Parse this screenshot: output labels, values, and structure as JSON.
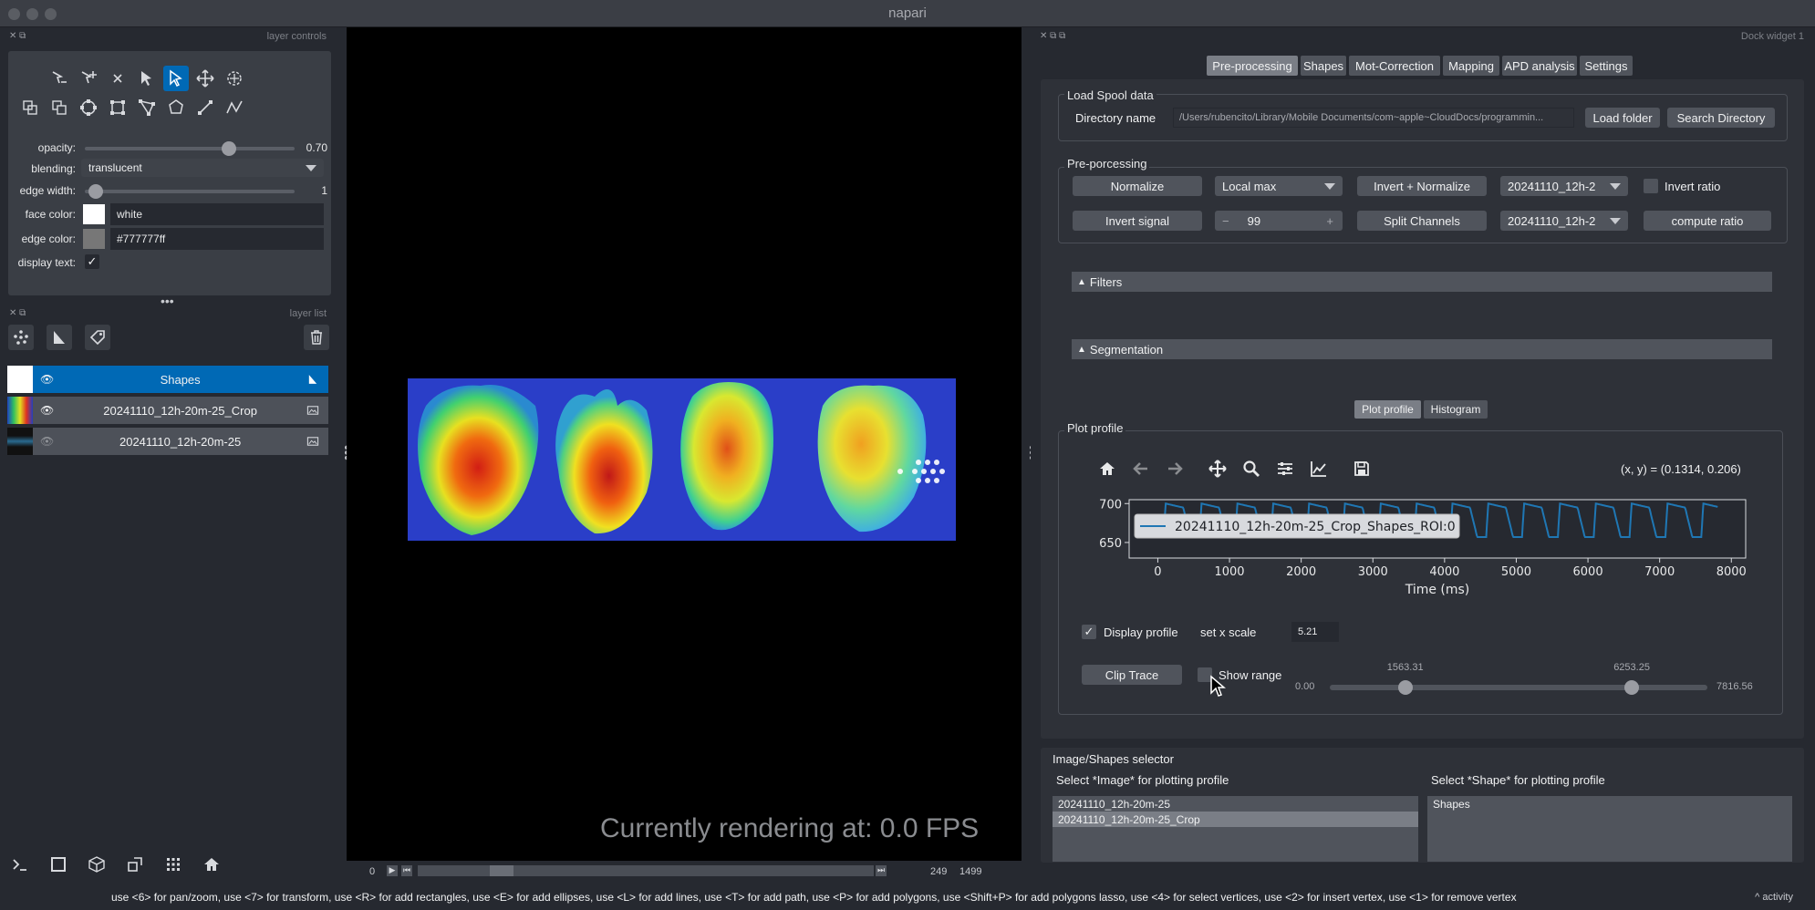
{
  "app": {
    "title": "napari"
  },
  "layer_controls": {
    "title": "layer controls",
    "opacity_label": "opacity:",
    "opacity_value": "0.70",
    "opacity_level": 0.7,
    "blending_label": "blending:",
    "blending_value": "translucent",
    "edge_width_label": "edge width:",
    "edge_width_value": "1",
    "face_color_label": "face color:",
    "face_color_value": "white",
    "face_color_hex": "#ffffff",
    "edge_color_label": "edge color:",
    "edge_color_value": "#777777ff",
    "edge_color_hex": "#777777",
    "display_text_label": "display text:",
    "display_text_checked": true
  },
  "layer_list": {
    "title": "layer list",
    "layers": [
      {
        "name": "Shapes",
        "visible": true,
        "selected": true
      },
      {
        "name": "20241110_12h-20m-25_Crop",
        "visible": true,
        "selected": false
      },
      {
        "name": "20241110_12h-20m-25",
        "visible": false,
        "selected": false
      }
    ]
  },
  "canvas": {
    "fps_text": "Currently rendering at: 0.0 FPS",
    "slider_start": "0",
    "slider_current": "249",
    "slider_max": "1499",
    "slider_level": 0.166
  },
  "dock": {
    "title": "Dock widget 1",
    "tabs": [
      "Pre-processing",
      "Shapes",
      "Mot-Correction",
      "Mapping",
      "APD analysis",
      "Settings"
    ],
    "active_tab": "Pre-processing",
    "load_spool": {
      "title": "Load Spool data",
      "dir_label": "Directory name",
      "dir_value": "/Users/rubencito/Library/Mobile Documents/com~apple~CloudDocs/programmin...",
      "load_btn": "Load folder",
      "search_btn": "Search Directory"
    },
    "preproc": {
      "title": "Pre-porcessing",
      "normalize_btn": "Normalize",
      "local_max": "Local max",
      "invert_normalize_btn": "Invert + Normalize",
      "dd1": "20241110_12h-2",
      "invert_ratio_label": "Invert ratio",
      "invert_signal_btn": "Invert signal",
      "spin_minus": "−",
      "spin_value": "99",
      "spin_plus": "+",
      "split_channels_btn": "Split Channels",
      "dd2": "20241110_12h-2",
      "compute_ratio_btn": "compute ratio"
    },
    "filters_label": "Filters",
    "segmentation_label": "Segmentation",
    "plot_tabs": [
      "Plot profile",
      "Histogram"
    ],
    "active_plot_tab": "Plot profile",
    "plot_profile": {
      "title": "Plot profile",
      "coords": "(x, y) = (0.1314, 0.206)",
      "display_profile_label": "Display profile",
      "set_x_scale_label": "set x scale",
      "x_scale_value": "5.21",
      "clip_trace_btn": "Clip Trace",
      "show_range_label": "Show range",
      "range_min": "0.00",
      "range_low": "1563.31",
      "range_high": "6253.25",
      "range_max": "7816.56"
    },
    "selector": {
      "title": "Image/Shapes selector",
      "image_label": "Select *Image* for plotting profile",
      "shape_label": "Select *Shape* for plotting profile",
      "images": [
        "20241110_12h-20m-25",
        "20241110_12h-20m-25_Crop"
      ],
      "selected_image": "20241110_12h-20m-25_Crop",
      "shapes": [
        "Shapes"
      ]
    }
  },
  "chart_data": {
    "type": "line",
    "title": "",
    "xlabel": "Time (ms)",
    "ylabel": "",
    "xlim": [
      -400,
      8200
    ],
    "ylim": [
      630,
      705
    ],
    "xticks": [
      0,
      1000,
      2000,
      3000,
      4000,
      5000,
      6000,
      7000,
      8000
    ],
    "yticks": [
      650,
      700
    ],
    "legend_location": "upper left",
    "series": [
      {
        "name": "20241110_12h-20m-25_Crop_Shapes_ROI:0",
        "color": "#1f77b4",
        "period_ms": 500,
        "peaks_count": 16,
        "baseline": 657,
        "peak": 700,
        "x_start": 80,
        "x_end": 7816.56
      }
    ]
  },
  "statusbar": {
    "hint": "use <6> for pan/zoom, use <7> for transform, use <R> for add rectangles, use <E> for add ellipses, use <L> for add lines, use <T> for add path, use <P> for add polygons, use <Shift+P> for add polygons lasso, use <4> for select vertices, use <2> for insert vertex, use <1> for remove vertex",
    "activity": "activity"
  }
}
